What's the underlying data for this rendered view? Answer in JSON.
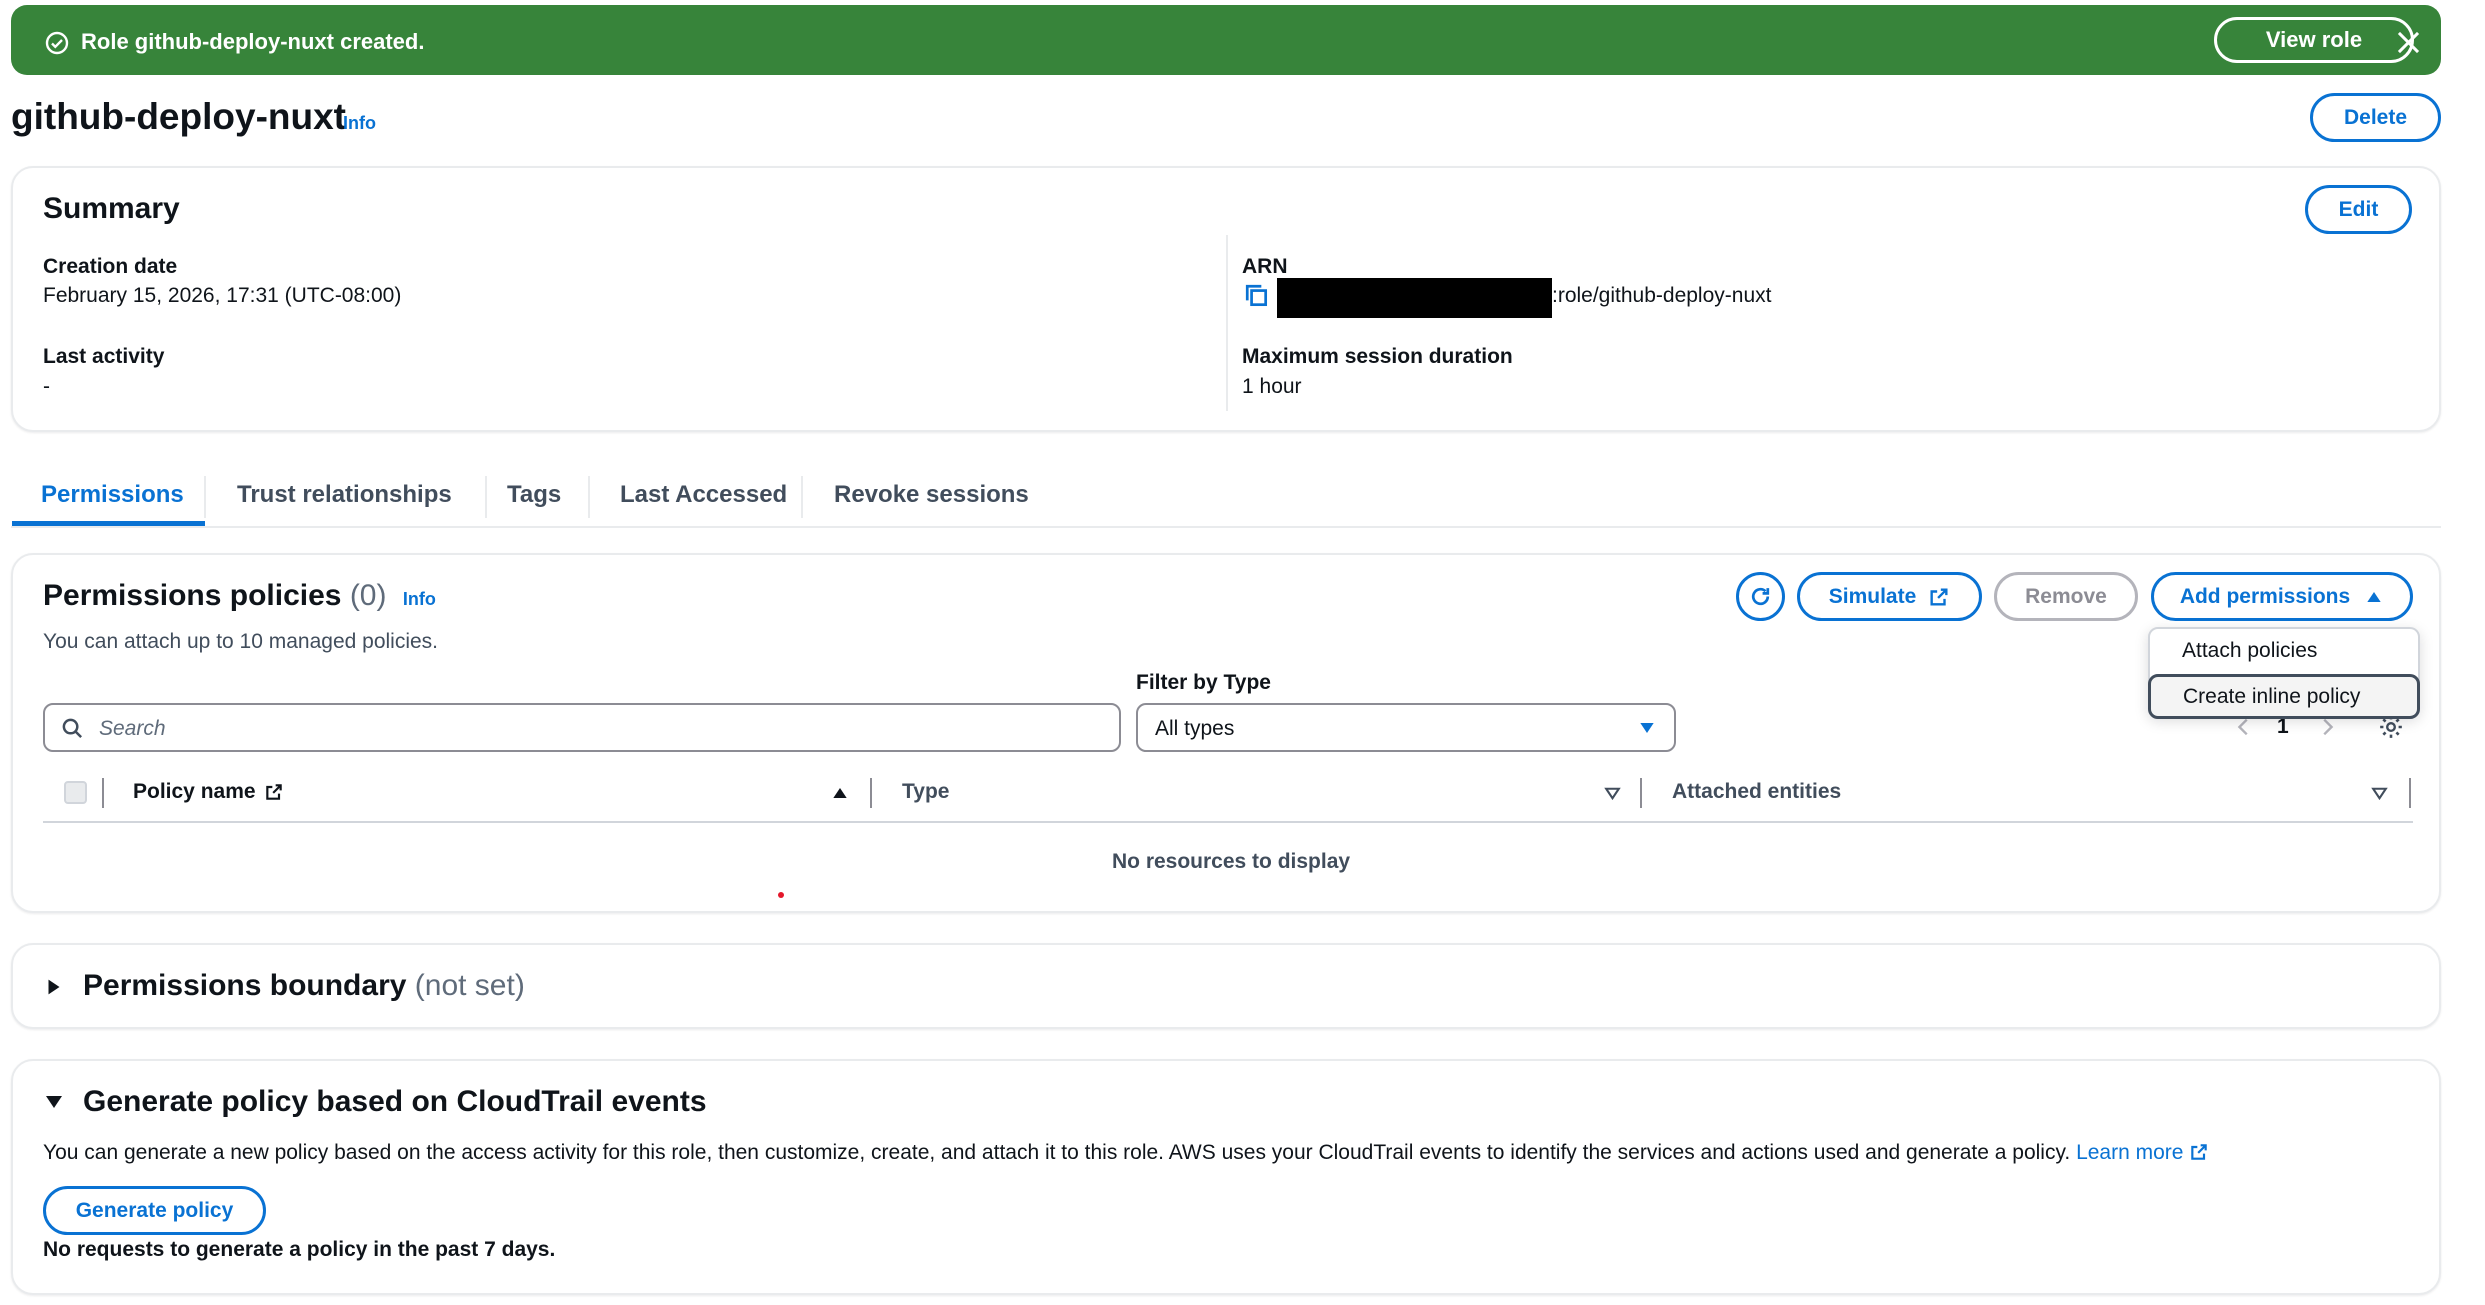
{
  "flash": {
    "message": "Role github-deploy-nuxt created.",
    "view_role": "View role",
    "color": "#37843a"
  },
  "header": {
    "title": "github-deploy-nuxt",
    "info": "Info",
    "delete": "Delete"
  },
  "summary": {
    "title": "Summary",
    "edit": "Edit",
    "creation_date_label": "Creation date",
    "creation_date": "February 15, 2026, 17:31 (UTC-08:00)",
    "last_activity_label": "Last activity",
    "last_activity": "-",
    "arn_label": "ARN",
    "arn_value": ":role/github-deploy-nuxt",
    "max_session_label": "Maximum session duration",
    "max_session": "1 hour"
  },
  "tabs": [
    "Permissions",
    "Trust relationships",
    "Tags",
    "Last Accessed",
    "Revoke sessions"
  ],
  "policies": {
    "title": "Permissions policies",
    "count": "(0)",
    "info": "Info",
    "description": "You can attach up to 10 managed policies.",
    "simulate": "Simulate",
    "remove": "Remove",
    "add_permissions": "Add permissions",
    "menu": [
      "Attach policies",
      "Create inline policy"
    ],
    "filter_label": "Filter by Type",
    "filter_value": "All types",
    "search_placeholder": "Search",
    "page": "1",
    "columns": [
      "Policy name",
      "Type",
      "Attached entities"
    ],
    "empty": "No resources to display"
  },
  "boundary": {
    "title": "Permissions boundary",
    "status": "(not set)"
  },
  "cloudtrail": {
    "title": "Generate policy based on CloudTrail events",
    "description": "You can generate a new policy based on the access activity for this role, then customize, create, and attach it to this role. AWS uses your CloudTrail events to identify the services and actions used and generate a policy.",
    "learn_more": "Learn more",
    "button": "Generate policy",
    "note": "No requests to generate a policy in the past 7 days."
  },
  "colors": {
    "accent": "#0972d3",
    "text": "#0f141a"
  }
}
